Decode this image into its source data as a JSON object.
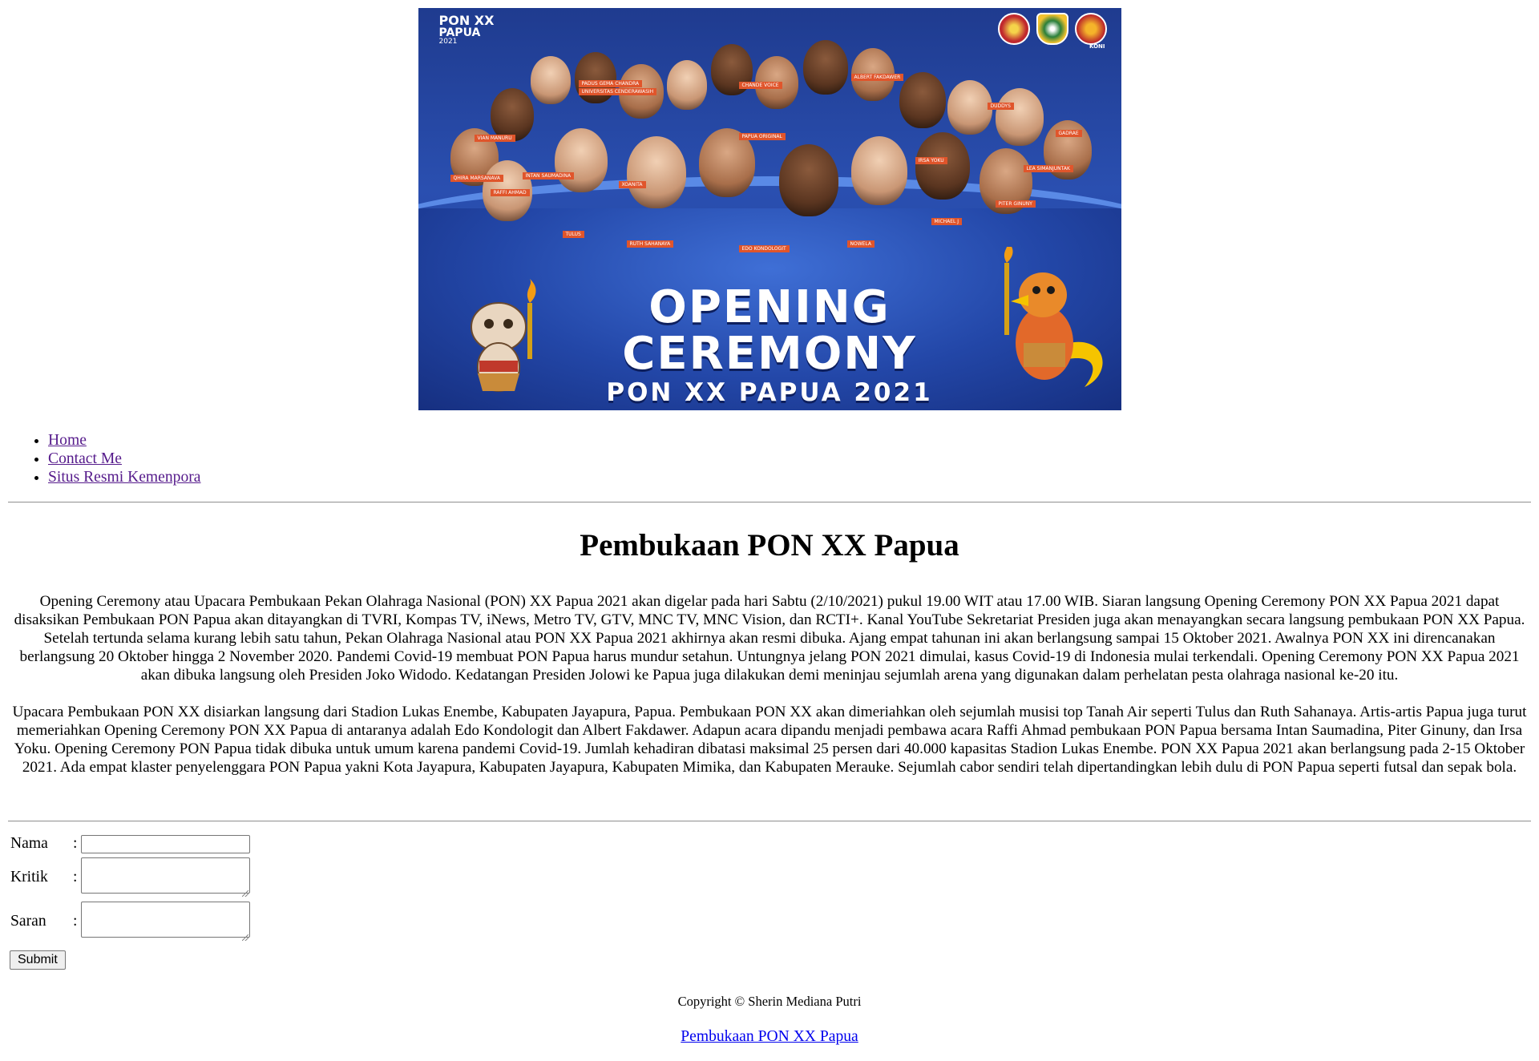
{
  "banner": {
    "logo": {
      "line1": "PON XX",
      "line2": "PAPUA",
      "line3": "2021"
    },
    "seal_caption": "KONI",
    "title_line1": "OPENING",
    "title_line2": "CEREMONY",
    "title_line3": "PON XX PAPUA 2021",
    "name_tags": [
      "PADUS GEMA CHANDRA",
      "UNIVERSITAS CENDERAWASIH",
      "VIAN MANURU",
      "CHANDE VOICE",
      "ALBERT FAKDAWER",
      "DUDDYS",
      "INTAN SAUMADINA",
      "QHIRA MARSANAVA",
      "XOANITA",
      "PAPUA ORIGINAL",
      "IRSA YOKU",
      "GADRAE",
      "LEA SIMANJUNTAK",
      "RAFFI AHMAD",
      "TULUS",
      "RUTH SAHANAYA",
      "EDO KONDOLOGIT",
      "NOWELA",
      "MICHAEL J",
      "PITER GINUNY"
    ]
  },
  "nav": {
    "items": [
      "Home",
      "Contact Me",
      "Situs Resmi Kemenpora"
    ]
  },
  "article": {
    "title": "Pembukaan PON XX Papua",
    "paragraphs": [
      "Opening Ceremony atau Upacara Pembukaan Pekan Olahraga Nasional (PON) XX Papua 2021 akan digelar pada hari Sabtu (2/10/2021) pukul 19.00 WIT atau 17.00 WIB. Siaran langsung Opening Ceremony PON XX Papua 2021 dapat disaksikan Pembukaan PON Papua akan ditayangkan di TVRI, Kompas TV, iNews, Metro TV, GTV, MNC TV, MNC Vision, dan RCTI+. Kanal YouTube Sekretariat Presiden juga akan menayangkan secara langsung pembukaan PON XX Papua. Setelah tertunda selama kurang lebih satu tahun, Pekan Olahraga Nasional atau PON XX Papua 2021 akhirnya akan resmi dibuka. Ajang empat tahunan ini akan berlangsung sampai 15 Oktober 2021. Awalnya PON XX ini direncanakan berlangsung 20 Oktober hingga 2 November 2020. Pandemi Covid-19 membuat PON Papua harus mundur setahun. Untungnya jelang PON 2021 dimulai, kasus Covid-19 di Indonesia mulai terkendali. Opening Ceremony PON XX Papua 2021 akan dibuka langsung oleh Presiden Joko Widodo. Kedatangan Presiden Jolowi ke Papua juga dilakukan demi meninjau sejumlah arena yang digunakan dalam perhelatan pesta olahraga nasional ke-20 itu.",
      "Upacara Pembukaan PON XX disiarkan langsung dari Stadion Lukas Enembe, Kabupaten Jayapura, Papua. Pembukaan PON XX akan dimeriahkan oleh sejumlah musisi top Tanah Air seperti Tulus dan Ruth Sahanaya. Artis-artis Papua juga turut memeriahkan Opening Ceremony PON XX Papua di antaranya adalah Edo Kondologit dan Albert Fakdawer. Adapun acara dipandu menjadi pembawa acara Raffi Ahmad pembukaan PON Papua bersama Intan Saumadina, Piter Ginuny, dan Irsa Yoku. Opening Ceremony PON Papua tidak dibuka untuk umum karena pandemi Covid-19. Jumlah kehadiran dibatasi maksimal 25 persen dari 40.000 kapasitas Stadion Lukas Enembe. PON XX Papua 2021 akan berlangsung pada 2-15 Oktober 2021. Ada empat klaster penyelenggara PON Papua yakni Kota Jayapura, Kabupaten Jayapura, Kabupaten Mimika, dan Kabupaten Merauke. Sejumlah cabor sendiri telah dipertandingkan lebih dulu di PON Papua seperti futsal dan sepak bola."
    ]
  },
  "form": {
    "fields": [
      {
        "label": "Nama",
        "value": ""
      },
      {
        "label": "Kritik",
        "value": ""
      },
      {
        "label": "Saran",
        "value": ""
      }
    ],
    "colon": ":",
    "submit_label": "Submit"
  },
  "footer": {
    "copyright": "Copyright © Sherin Mediana Putri",
    "link": "Pembukaan PON XX Papua"
  }
}
